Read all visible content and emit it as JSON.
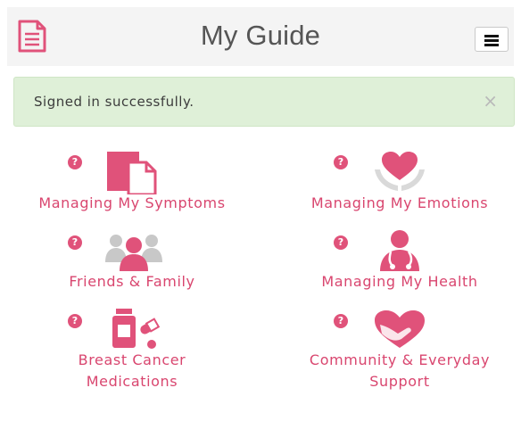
{
  "header": {
    "title": "My Guide",
    "doc_icon": "document-icon",
    "menu_icon": "hamburger-menu-icon"
  },
  "alert": {
    "message": "Signed in successfully.",
    "close_glyph": "×"
  },
  "tiles": [
    {
      "label": "Managing My Symptoms",
      "icon": "symptoms-icon",
      "help": "?"
    },
    {
      "label": "Managing My Emotions",
      "icon": "heart-hands-icon",
      "help": "?"
    },
    {
      "label": "Friends & Family",
      "icon": "people-group-icon",
      "help": "?"
    },
    {
      "label": "Managing My Health",
      "icon": "doctor-icon",
      "help": "?"
    },
    {
      "label": "Breast Cancer",
      "label2": "Medications",
      "icon": "pills-icon",
      "help": "?"
    },
    {
      "label": "Community & Everyday",
      "label2": "Support",
      "icon": "heart-hand-icon",
      "help": "?"
    }
  ],
  "colors": {
    "accent": "#e0527a",
    "alert_bg": "#dff0d8",
    "header_bg": "#f4f4f4"
  }
}
